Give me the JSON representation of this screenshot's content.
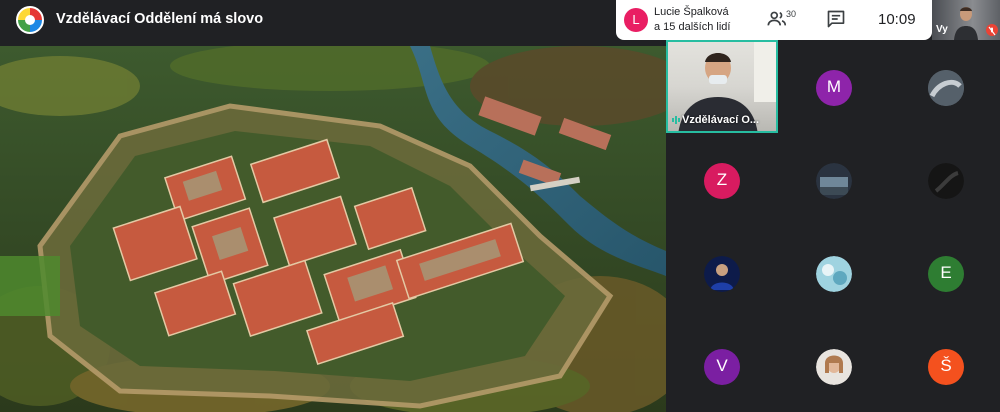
{
  "meeting": {
    "title": "Vzdělávací Oddělení má slovo"
  },
  "pinned": {
    "initial": "L",
    "line1": "Lucie Špalková",
    "line2": "a 15 dalších lidí",
    "color": "#e91e63"
  },
  "controls": {
    "people_count": "30",
    "people_icon": "people-icon",
    "chat_icon": "chat-icon",
    "clock": "10:09"
  },
  "self_view": {
    "label": "Vy",
    "mic_icon": "mic-off-icon"
  },
  "speaker": {
    "label": "Vzdělávací O...",
    "border_color": "#27bda1"
  },
  "participants": [
    {
      "initial": "M",
      "color": "#8e24aa"
    },
    {
      "initial": "Z",
      "color": "#d81b60"
    },
    {
      "initial": "E",
      "color": "#2e7d32"
    },
    {
      "initial": "V",
      "color": "#7b1fa2"
    },
    {
      "initial": "Š",
      "color": "#f4511e"
    }
  ]
}
